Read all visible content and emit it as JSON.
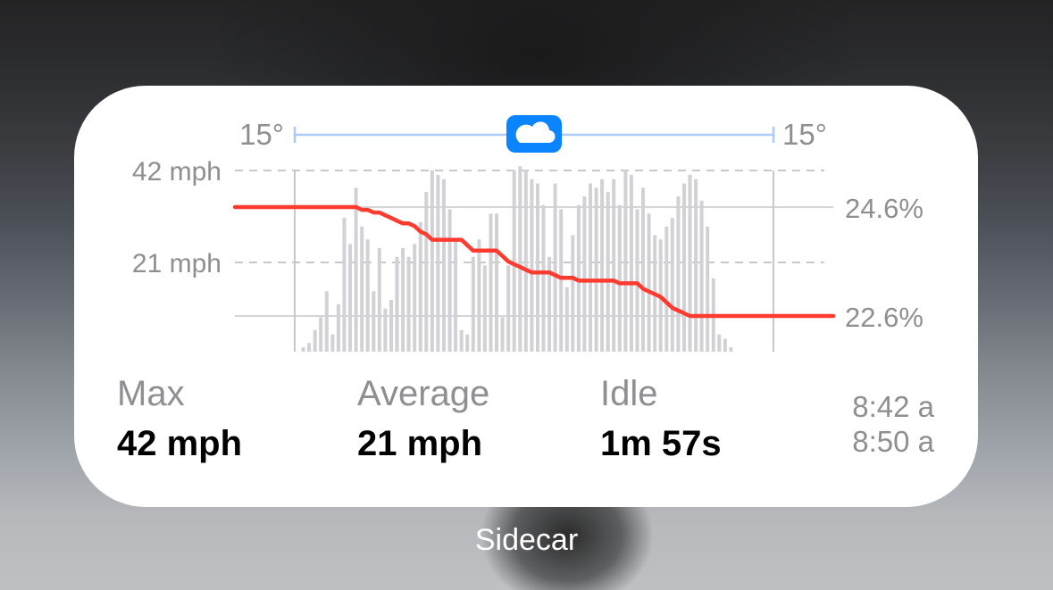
{
  "widget": {
    "app_name": "Sidecar",
    "weather": {
      "temp_start": "15°",
      "temp_end": "15°",
      "condition_icon": "cloud-icon"
    },
    "speed_axis": {
      "top_label": "42 mph",
      "mid_label": "21 mph"
    },
    "battery_axis": {
      "start_label": "24.6%",
      "end_label": "22.6%"
    },
    "stats": [
      {
        "label": "Max",
        "value": "42 mph"
      },
      {
        "label": "Average",
        "value": "21 mph"
      },
      {
        "label": "Idle",
        "value": "1m 57s"
      }
    ],
    "times": {
      "start": "8:42 a",
      "end": "8:50 a"
    }
  },
  "colors": {
    "battery_line": "#ff3b30",
    "speed_bars": "#d1d1d6",
    "weather_track": "#a9cbf5",
    "weather_icon_bg": "#0a84ff",
    "secondary_text": "#8e8e93"
  },
  "chart_data": {
    "type": "bar",
    "ylim": [
      0,
      42
    ],
    "speed_mph": [
      0,
      1,
      2,
      5,
      8,
      14,
      4,
      11,
      31,
      25,
      38,
      29,
      26,
      14,
      24,
      10,
      12,
      22,
      24,
      22,
      25,
      30,
      37,
      42,
      41,
      40,
      33,
      26,
      5,
      4,
      22,
      26,
      20,
      32,
      32,
      8,
      20,
      42,
      43,
      42,
      40,
      39,
      34,
      22,
      39,
      33,
      15,
      27,
      34,
      36,
      39,
      38,
      40,
      37,
      40,
      34,
      42,
      41,
      33,
      38,
      32,
      27,
      26,
      29,
      31,
      36,
      39,
      41,
      40,
      35,
      29,
      17,
      4,
      3,
      1,
      0
    ],
    "battery_percent": [
      24.6,
      24.6,
      24.6,
      24.6,
      24.6,
      24.6,
      24.6,
      24.6,
      24.6,
      24.6,
      24.6,
      24.55,
      24.55,
      24.5,
      24.5,
      24.45,
      24.4,
      24.35,
      24.3,
      24.3,
      24.25,
      24.15,
      24.1,
      24.0,
      24.0,
      24.0,
      24.0,
      24.0,
      24.0,
      23.9,
      23.8,
      23.8,
      23.8,
      23.8,
      23.8,
      23.7,
      23.6,
      23.55,
      23.5,
      23.45,
      23.4,
      23.4,
      23.4,
      23.4,
      23.35,
      23.3,
      23.3,
      23.3,
      23.25,
      23.25,
      23.25,
      23.25,
      23.25,
      23.25,
      23.25,
      23.2,
      23.2,
      23.2,
      23.2,
      23.1,
      23.05,
      23.0,
      22.95,
      22.85,
      22.75,
      22.7,
      22.65,
      22.6,
      22.6,
      22.6,
      22.6,
      22.6,
      22.6,
      22.6,
      22.6,
      22.6
    ]
  }
}
